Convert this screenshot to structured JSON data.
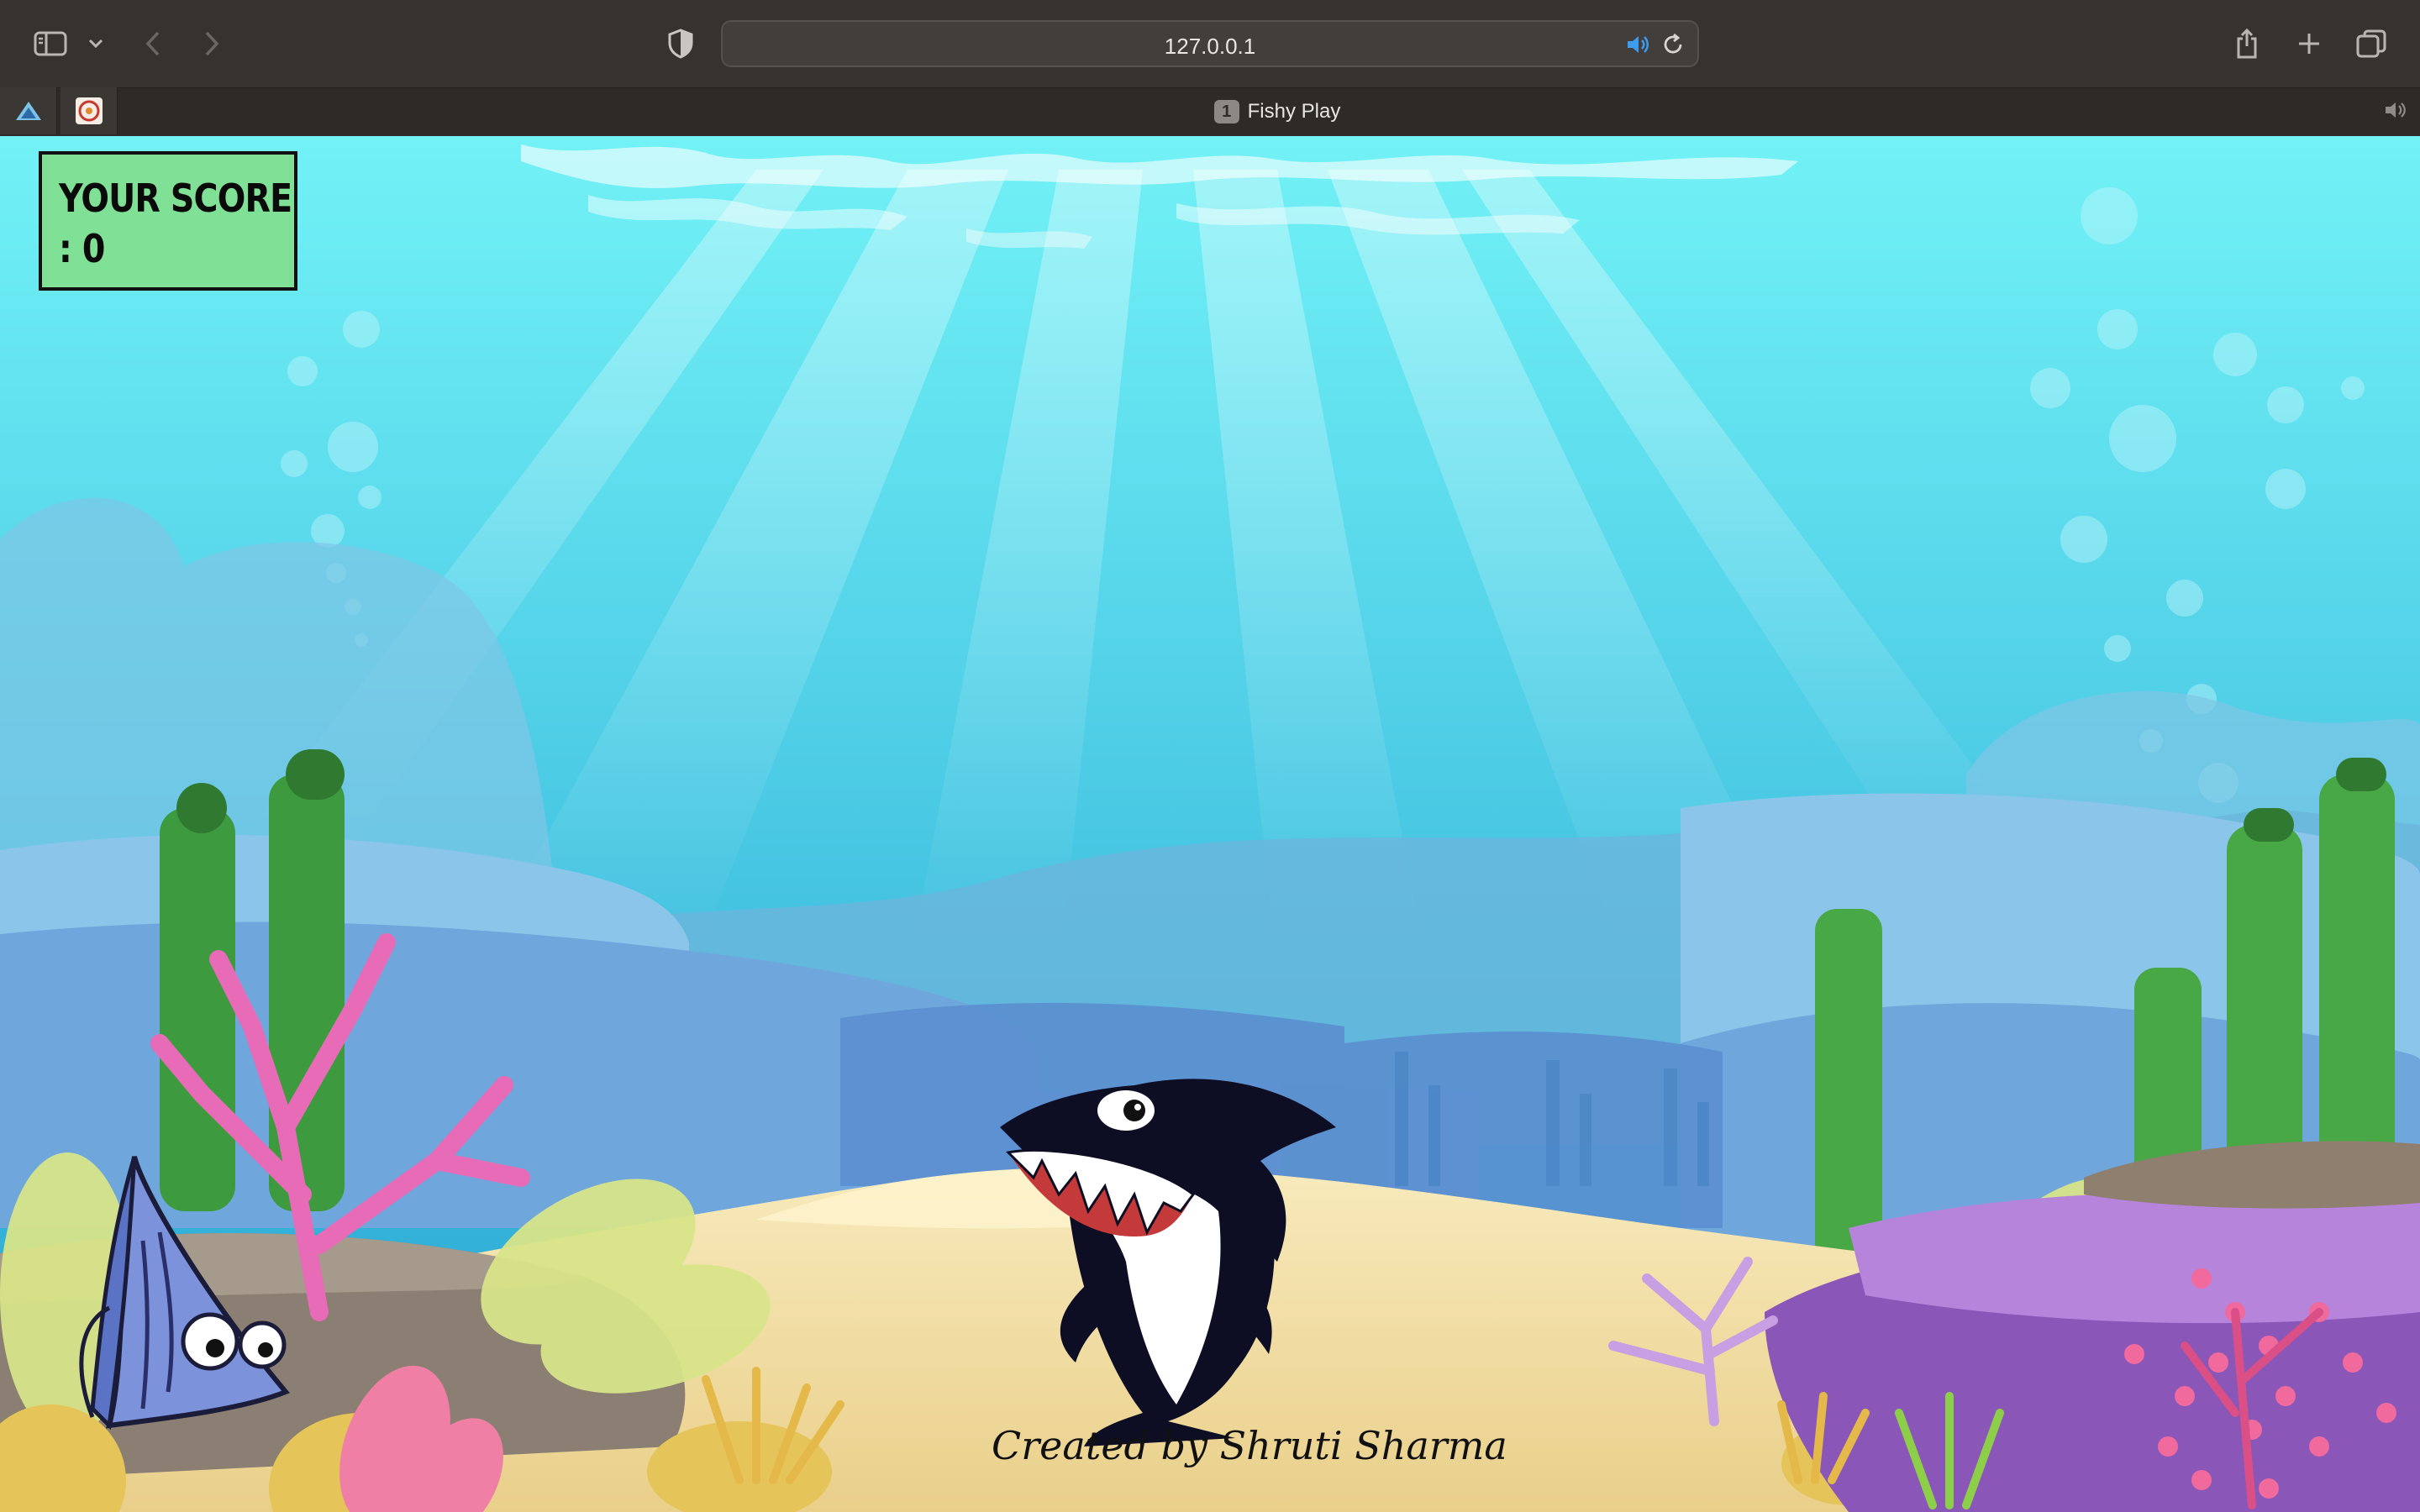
{
  "browser": {
    "url": "127.0.0.1",
    "tab_badge": "1",
    "tab_title": "Fishy Play",
    "icons": {
      "sidebar": "sidebar-toggle-icon",
      "chevron": "chevron-down-icon",
      "back": "back-arrow-icon",
      "forward": "forward-arrow-icon",
      "shield": "privacy-shield-icon",
      "audio": "speaker-icon",
      "reload": "reload-icon",
      "share": "share-icon",
      "new_tab": "plus-icon",
      "tabs": "tab-overview-icon"
    }
  },
  "game": {
    "score_label": "YOUR SCORE",
    "score_value": ": 0",
    "credit": "Created by Shruti Sharma",
    "colors": {
      "water_top": "#6ff3f5",
      "water_bottom": "#2fb1d6",
      "sand": "#f3dfa6",
      "score_bg": "#7fe096"
    }
  }
}
